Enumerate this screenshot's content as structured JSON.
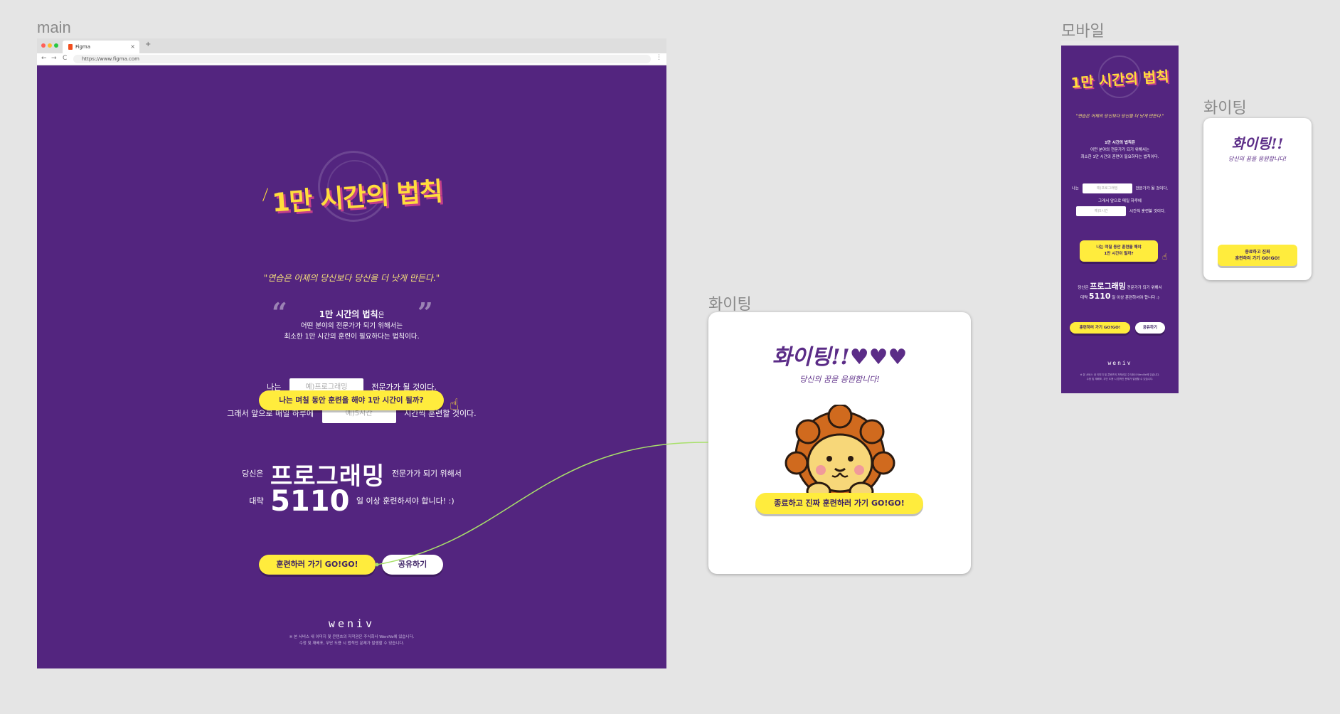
{
  "frames": {
    "main_label": "main",
    "modal_label": "화이팅",
    "mobile_label": "모바일",
    "modal_small_label": "화이팅"
  },
  "browser": {
    "tab_title": "Figma",
    "tab_close": "×",
    "new_tab": "+",
    "url": "https://www.figma.com",
    "back": "←",
    "forward": "→",
    "reload": "C",
    "menu": "⋮"
  },
  "colors": {
    "background": "#53257f",
    "accent": "#ffec3d",
    "canvas": "#e5e5e5"
  },
  "hero": {
    "logo": "1만 시간의 법칙",
    "quote": "\"연습은 어제의 당신보다 당신을 더 낫게 만든다.\"",
    "law_title": "1만 시간의 법칙",
    "law_suffix": "은",
    "law_line1": "어떤 분야의 전문가가 되기 위해서는",
    "law_line2": "최소한 1만 시간의 훈련이 필요하다는 법칙이다.",
    "open_quote": "“",
    "close_quote": "”"
  },
  "form": {
    "row1_prefix": "나는",
    "field_placeholder": "예)프로그래밍",
    "row1_suffix": "전문가가 될 것이다.",
    "row2_prefix": "그래서 앞으로 매일 하루에",
    "hours_placeholder": "예)5시간",
    "row2_suffix": "시간씩 훈련할 것이다.",
    "submit": "나는 며칠 동안 훈련을 해야 1만 시간이 될까?"
  },
  "result": {
    "prefix": "당신은",
    "field": "프로그래밍",
    "suffix": "전문가가 되기 위해서",
    "days_prefix": "대략",
    "days": "5110",
    "days_suffix": "일 이상 훈련하셔야 합니다! :)"
  },
  "actions": {
    "go": "훈련하러 가기 GO!GO!",
    "share": "공유하기"
  },
  "footer": {
    "brand": "weniv",
    "line1": "※ 본 서비스 내 이미지 및 콘텐츠의 저작권은 주식회사 WeniVe에 있습니다.",
    "line2": "수정 및 재배포, 무단 도용 시 법적인 문제가 발생할 수 있습니다."
  },
  "modal": {
    "title": "화이팅!!♥♥♥",
    "subtitle": "당신의 꿈을 응원합니다!",
    "button": "종료하고 진짜 훈련하러 가기 GO!GO!"
  },
  "mobile": {
    "logo": "1만 시간의 법칙",
    "quote": "\"연습은 어제의 당신보다 당신을 더 낫게 만든다.\"",
    "law_title": "1만 시간의 법칙은",
    "law_line1": "어떤 분야의 전문가가 되기 위해서는",
    "law_line2": "최소한 1만 시간의 훈련이 필요하다는 법칙이다.",
    "row1_prefix": "나는",
    "field_placeholder": "예)프로그래밍",
    "row1_suffix": "전문가가 될 것이다.",
    "row2_text": "그래서 앞으로 매일 하루에",
    "hours_placeholder": "예)5시간",
    "row2_suffix": "시간씩 훈련할 것이다.",
    "submit_line1": "나는 며칠 동안 훈련을 해야",
    "submit_line2": "1만 시간이 될까?",
    "result_prefix": "당신은",
    "result_field": "프로그래밍",
    "result_suffix": "전문가가 되기 위해서",
    "days_prefix": "대략",
    "days": "5110",
    "days_suffix": "일 이상 훈련하셔야 합니다 :)",
    "go": "훈련하러 가기 GO!GO!",
    "share": "공유하기",
    "brand": "weniv",
    "footer1": "※ 본 서비스 내 이미지 및 콘텐츠의 저작권은 주식회사 WeniVe에 있습니다.",
    "footer2": "수정 및 재배포, 무단 도용 시 법적인 문제가 발생할 수 있습니다."
  },
  "modal_small": {
    "title": "화이팅!!",
    "subtitle": "당신의 꿈을 응원합니다!",
    "button_line1": "종료하고 진짜",
    "button_line2": "훈련하러 가기 GO!GO!"
  }
}
